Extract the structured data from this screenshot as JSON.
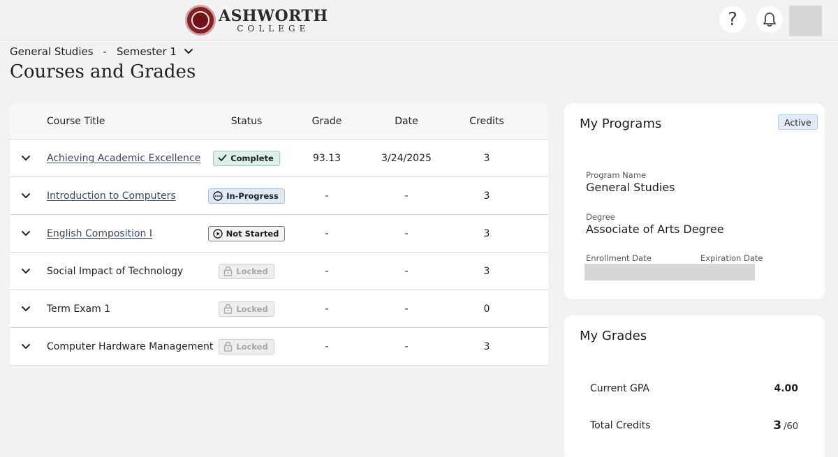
{
  "header": {
    "logo_top": "ASHWORTH",
    "logo_bottom": "COLLEGE",
    "help_glyph": "?",
    "help_icon": "question-mark-icon",
    "notifications_icon": "bell-icon"
  },
  "breadcrumb": {
    "program": "General Studies",
    "separator": "-",
    "term": "Semester 1"
  },
  "page_title": "Courses and Grades",
  "table": {
    "columns": [
      "Course Title",
      "Status",
      "Grade",
      "Date",
      "Credits"
    ],
    "rows": [
      {
        "title": "Achieving Academic Excellence",
        "link": true,
        "status": "Complete",
        "status_icon": "check-icon",
        "grade": "93.13",
        "date": "3/24/2025",
        "credits": "3"
      },
      {
        "title": "Introduction to Computers",
        "link": true,
        "status": "In-Progress",
        "status_icon": "ellipsis-circle-icon",
        "grade": "-",
        "date": "-",
        "credits": "3"
      },
      {
        "title": "English Composition I",
        "link": true,
        "status": "Not Started",
        "status_icon": "play-circle-icon",
        "grade": "-",
        "date": "-",
        "credits": "3"
      },
      {
        "title": "Social Impact of Technology",
        "link": false,
        "status": "Locked",
        "status_icon": "lock-icon",
        "grade": "-",
        "date": "-",
        "credits": "3"
      },
      {
        "title": "Term Exam 1",
        "link": false,
        "status": "Locked",
        "status_icon": "lock-icon",
        "grade": "-",
        "date": "-",
        "credits": "0"
      },
      {
        "title": "Computer Hardware Management",
        "link": false,
        "status": "Locked",
        "status_icon": "lock-icon",
        "grade": "-",
        "date": "-",
        "credits": "3"
      }
    ]
  },
  "programs": {
    "title": "My Programs",
    "status": "Active",
    "program_name_label": "Program Name",
    "program_name": "General Studies",
    "degree_label": "Degree",
    "degree": "Associate of Arts Degree",
    "enrollment_date_label": "Enrollment Date",
    "expiration_date_label": "Expiration Date"
  },
  "grades": {
    "title": "My Grades",
    "gpa_label": "Current GPA",
    "gpa": "4.00",
    "credits_label": "Total Credits",
    "credits_earned": "3",
    "credits_required": "/60"
  },
  "colors": {
    "complete_bg": "#d9efe8",
    "in_progress_bg": "#dde9f5",
    "locked_text": "#a8a8a8",
    "link_text": "#3a4a5e",
    "logo_red": "#8b1c22"
  }
}
